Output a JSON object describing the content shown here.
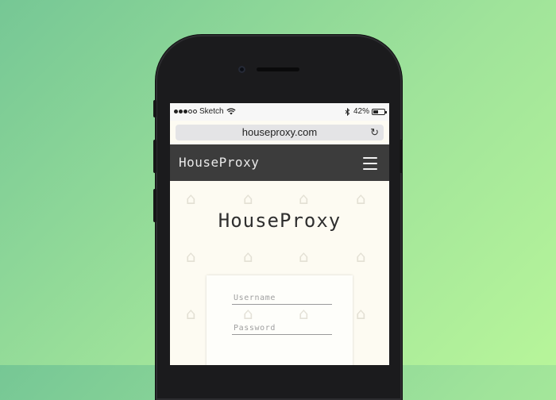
{
  "colors": {
    "navbar": "#3c3c3c",
    "content_bg": "#fdfbf2",
    "background_gradient_start": "#76c795",
    "background_gradient_end": "#b7f59a"
  },
  "status_bar": {
    "carrier": "Sketch",
    "signal_bars": 5,
    "signal_filled": 3,
    "battery_percent": "42%",
    "wifi_icon": "wifi-icon",
    "bluetooth_icon": "bluetooth-icon"
  },
  "browser": {
    "url": "houseproxy.com",
    "reload_icon": "reload-icon"
  },
  "navbar": {
    "brand": "HouseProxy",
    "menu_icon": "hamburger-menu-icon"
  },
  "hero": {
    "title": "HouseProxy"
  },
  "login": {
    "username_placeholder": "Username",
    "password_placeholder": "Password"
  }
}
